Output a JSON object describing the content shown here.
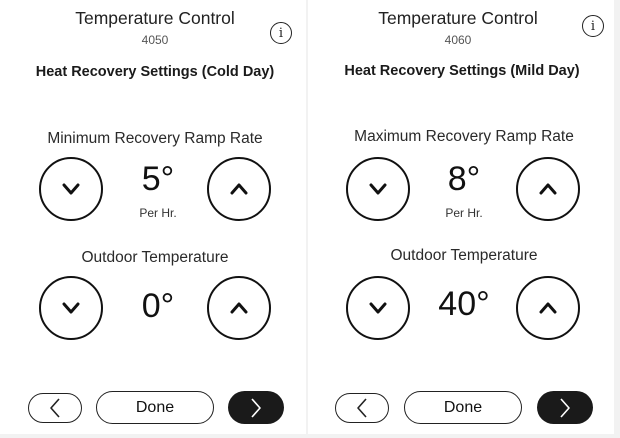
{
  "panels": [
    {
      "title": "Temperature Control",
      "model": "4050",
      "subtitle": "Heat Recovery Settings (Cold Day)",
      "setting1": {
        "label": "Minimum Recovery Ramp Rate",
        "value": "5°",
        "unit": "Per Hr."
      },
      "setting2": {
        "label": "Outdoor Temperature",
        "value": "0°"
      },
      "done_label": "Done"
    },
    {
      "title": "Temperature Control",
      "model": "4060",
      "subtitle": "Heat Recovery Settings (Mild Day)",
      "setting1": {
        "label": "Maximum Recovery Ramp Rate",
        "value": "8°",
        "unit": "Per Hr."
      },
      "setting2": {
        "label": "Outdoor Temperature",
        "value": "40°"
      },
      "done_label": "Done"
    }
  ],
  "icons": {
    "info": "info-icon",
    "decrease": "chevron-down-icon",
    "increase": "chevron-up-icon",
    "back": "chevron-left-icon",
    "next": "chevron-right-icon"
  },
  "colors": {
    "primary_button": "#1a1a1a",
    "background": "#ffffff",
    "outline": "#111111"
  }
}
